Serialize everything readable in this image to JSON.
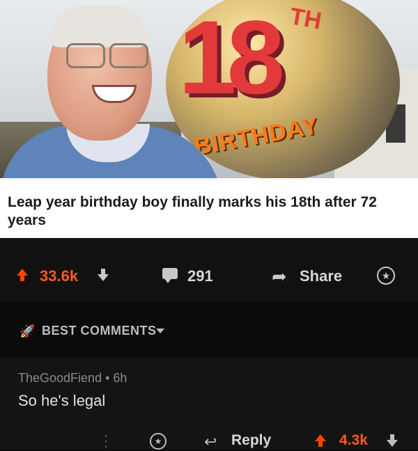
{
  "image": {
    "balloon_number": "18",
    "balloon_suffix": "TH",
    "balloon_text": "BIRTHDAY"
  },
  "post": {
    "headline": "Leap year birthday boy finally marks his 18th after 72 years",
    "score": "33.6k",
    "comment_count": "291",
    "share_label": "Share"
  },
  "sort": {
    "label": "BEST COMMENTS"
  },
  "comment": {
    "author": "TheGoodFiend",
    "time": "6h",
    "separator": "•",
    "body": "So he's legal",
    "reply_label": "Reply",
    "score": "4.3k"
  },
  "colors": {
    "upvote": "#ff4500",
    "background": "#0b0b0b",
    "text_primary": "#d7d7d7"
  }
}
